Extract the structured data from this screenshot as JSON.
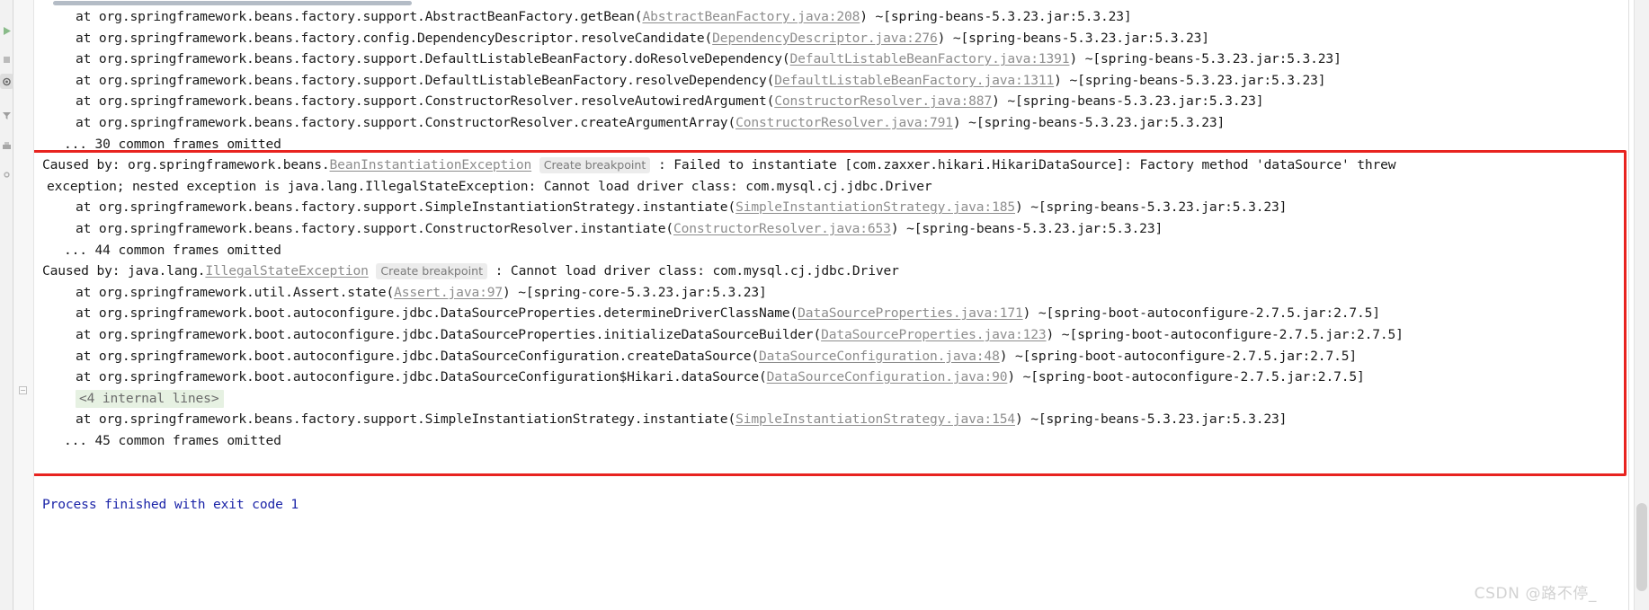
{
  "app": {
    "name": "IntelliJ IDEA Run Console",
    "watermark": "CSDN @路不停_"
  },
  "colors": {
    "annotation_red": "#e8231f",
    "link_gray": "#8d8d8d",
    "exit_blue": "#1b24a8",
    "internal_lines_bg": "#e6f1e2",
    "breakpoint_badge_bg": "#ececec",
    "console_bg": "#ffffff",
    "gutter_bg": "#f7f7f7",
    "watermark": "#d2d2d2"
  },
  "left_toolbar": {
    "items": [
      {
        "name": "rerun-icon",
        "label": "Rerun"
      },
      {
        "name": "stop-icon",
        "label": "Stop"
      },
      {
        "name": "debug-icon",
        "label": "Debug",
        "selected": true
      },
      {
        "name": "filter-icon",
        "label": "Filter"
      },
      {
        "name": "print-icon",
        "label": "Print"
      },
      {
        "name": "settings-icon",
        "label": "Settings"
      }
    ]
  },
  "scrollbars": {
    "horizontal_thumb_label": "horizontal-scroll-thumb",
    "vertical_thumb_label": "vertical-scroll-thumb"
  },
  "gutter": {
    "fold_marker_glyph": "−",
    "fold_marker_label": "collapsed-internal-lines-fold"
  },
  "console": {
    "lines": [
      {
        "id": "l1",
        "indent": "at",
        "segments": [
          {
            "t": "at org.springframework.beans.factory.support.AbstractBeanFactory.getBean(",
            "k": "plain"
          },
          {
            "t": "AbstractBeanFactory.java:208",
            "k": "link"
          },
          {
            "t": ") ~[spring-beans-5.3.23.jar:5.3.23]",
            "k": "plain"
          }
        ]
      },
      {
        "id": "l2",
        "indent": "at",
        "segments": [
          {
            "t": "at org.springframework.beans.factory.config.DependencyDescriptor.resolveCandidate(",
            "k": "plain"
          },
          {
            "t": "DependencyDescriptor.java:276",
            "k": "link"
          },
          {
            "t": ") ~[spring-beans-5.3.23.jar:5.3.23]",
            "k": "plain"
          }
        ]
      },
      {
        "id": "l3",
        "indent": "at",
        "segments": [
          {
            "t": "at org.springframework.beans.factory.support.DefaultListableBeanFactory.doResolveDependency(",
            "k": "plain"
          },
          {
            "t": "DefaultListableBeanFactory.java:1391",
            "k": "link"
          },
          {
            "t": ") ~[spring-beans-5.3.23.jar:5.3.23]",
            "k": "plain"
          }
        ]
      },
      {
        "id": "l4",
        "indent": "at",
        "segments": [
          {
            "t": "at org.springframework.beans.factory.support.DefaultListableBeanFactory.resolveDependency(",
            "k": "plain"
          },
          {
            "t": "DefaultListableBeanFactory.java:1311",
            "k": "link"
          },
          {
            "t": ") ~[spring-beans-5.3.23.jar:5.3.23]",
            "k": "plain"
          }
        ]
      },
      {
        "id": "l5",
        "indent": "at",
        "segments": [
          {
            "t": "at org.springframework.beans.factory.support.ConstructorResolver.resolveAutowiredArgument(",
            "k": "plain"
          },
          {
            "t": "ConstructorResolver.java:887",
            "k": "link"
          },
          {
            "t": ") ~[spring-beans-5.3.23.jar:5.3.23]",
            "k": "plain"
          }
        ]
      },
      {
        "id": "l6",
        "indent": "at",
        "segments": [
          {
            "t": "at org.springframework.beans.factory.support.ConstructorResolver.createArgumentArray(",
            "k": "plain"
          },
          {
            "t": "ConstructorResolver.java:791",
            "k": "link"
          },
          {
            "t": ") ~[spring-beans-5.3.23.jar:5.3.23]",
            "k": "plain"
          }
        ]
      },
      {
        "id": "l7",
        "indent": "dots",
        "segments": [
          {
            "t": "... 30 common frames omitted",
            "k": "plain"
          }
        ]
      },
      {
        "id": "l8",
        "indent": "none",
        "segments": [
          {
            "t": "Caused by: org.springframework.beans.",
            "k": "plain"
          },
          {
            "t": "BeanInstantiationException",
            "k": "exception"
          },
          {
            "t": "Create breakpoint",
            "k": "badge"
          },
          {
            "t": ": Failed to instantiate [com.zaxxer.hikari.HikariDataSource]: Factory method 'dataSource' threw",
            "k": "plain"
          }
        ]
      },
      {
        "id": "l9",
        "indent": "cont",
        "segments": [
          {
            "t": "exception; nested exception is java.lang.IllegalStateException: Cannot load driver class: com.mysql.cj.jdbc.Driver",
            "k": "plain"
          }
        ]
      },
      {
        "id": "l10",
        "indent": "at",
        "segments": [
          {
            "t": "at org.springframework.beans.factory.support.SimpleInstantiationStrategy.instantiate(",
            "k": "plain"
          },
          {
            "t": "SimpleInstantiationStrategy.java:185",
            "k": "link"
          },
          {
            "t": ") ~[spring-beans-5.3.23.jar:5.3.23]",
            "k": "plain"
          }
        ]
      },
      {
        "id": "l11",
        "indent": "at",
        "segments": [
          {
            "t": "at org.springframework.beans.factory.support.ConstructorResolver.instantiate(",
            "k": "plain"
          },
          {
            "t": "ConstructorResolver.java:653",
            "k": "link"
          },
          {
            "t": ") ~[spring-beans-5.3.23.jar:5.3.23]",
            "k": "plain"
          }
        ]
      },
      {
        "id": "l12",
        "indent": "dots",
        "segments": [
          {
            "t": "... 44 common frames omitted",
            "k": "plain"
          }
        ]
      },
      {
        "id": "l13",
        "indent": "none",
        "segments": [
          {
            "t": "Caused by: java.lang.",
            "k": "plain"
          },
          {
            "t": "IllegalStateException",
            "k": "exception"
          },
          {
            "t": "Create breakpoint",
            "k": "badge"
          },
          {
            "t": ": Cannot load driver class: com.mysql.cj.jdbc.Driver",
            "k": "plain"
          }
        ]
      },
      {
        "id": "l14",
        "indent": "at",
        "segments": [
          {
            "t": "at org.springframework.util.Assert.state(",
            "k": "plain"
          },
          {
            "t": "Assert.java:97",
            "k": "link"
          },
          {
            "t": ") ~[spring-core-5.3.23.jar:5.3.23]",
            "k": "plain"
          }
        ]
      },
      {
        "id": "l15",
        "indent": "at",
        "segments": [
          {
            "t": "at org.springframework.boot.autoconfigure.jdbc.DataSourceProperties.determineDriverClassName(",
            "k": "plain"
          },
          {
            "t": "DataSourceProperties.java:171",
            "k": "link"
          },
          {
            "t": ") ~[spring-boot-autoconfigure-2.7.5.jar:2.7.5]",
            "k": "plain"
          }
        ]
      },
      {
        "id": "l16",
        "indent": "at",
        "segments": [
          {
            "t": "at org.springframework.boot.autoconfigure.jdbc.DataSourceProperties.initializeDataSourceBuilder(",
            "k": "plain"
          },
          {
            "t": "DataSourceProperties.java:123",
            "k": "link"
          },
          {
            "t": ") ~[spring-boot-autoconfigure-2.7.5.jar:2.7.5]",
            "k": "plain"
          }
        ]
      },
      {
        "id": "l17",
        "indent": "at",
        "segments": [
          {
            "t": "at org.springframework.boot.autoconfigure.jdbc.DataSourceConfiguration.createDataSource(",
            "k": "plain"
          },
          {
            "t": "DataSourceConfiguration.java:48",
            "k": "link"
          },
          {
            "t": ") ~[spring-boot-autoconfigure-2.7.5.jar:2.7.5]",
            "k": "plain"
          }
        ]
      },
      {
        "id": "l18",
        "indent": "at",
        "segments": [
          {
            "t": "at org.springframework.boot.autoconfigure.jdbc.DataSourceConfiguration$Hikari.dataSource(",
            "k": "plain"
          },
          {
            "t": "DataSourceConfiguration.java:90",
            "k": "link"
          },
          {
            "t": ") ~[spring-boot-autoconfigure-2.7.5.jar:2.7.5]",
            "k": "plain"
          }
        ]
      },
      {
        "id": "l19",
        "indent": "fold",
        "segments": [
          {
            "t": "<4 internal lines>",
            "k": "internal"
          }
        ]
      },
      {
        "id": "l20",
        "indent": "at",
        "segments": [
          {
            "t": "at org.springframework.beans.factory.support.SimpleInstantiationStrategy.instantiate(",
            "k": "plain"
          },
          {
            "t": "SimpleInstantiationStrategy.java:154",
            "k": "link"
          },
          {
            "t": ") ~[spring-beans-5.3.23.jar:5.3.23]",
            "k": "plain"
          }
        ]
      },
      {
        "id": "l21",
        "indent": "dots",
        "segments": [
          {
            "t": "... 45 common frames omitted",
            "k": "plain"
          }
        ]
      },
      {
        "id": "l22",
        "indent": "none",
        "segments": []
      },
      {
        "id": "l23",
        "indent": "none",
        "segments": []
      },
      {
        "id": "l24",
        "indent": "none",
        "segments": [
          {
            "t": "Process finished with exit code 1",
            "k": "exit"
          }
        ]
      }
    ]
  }
}
